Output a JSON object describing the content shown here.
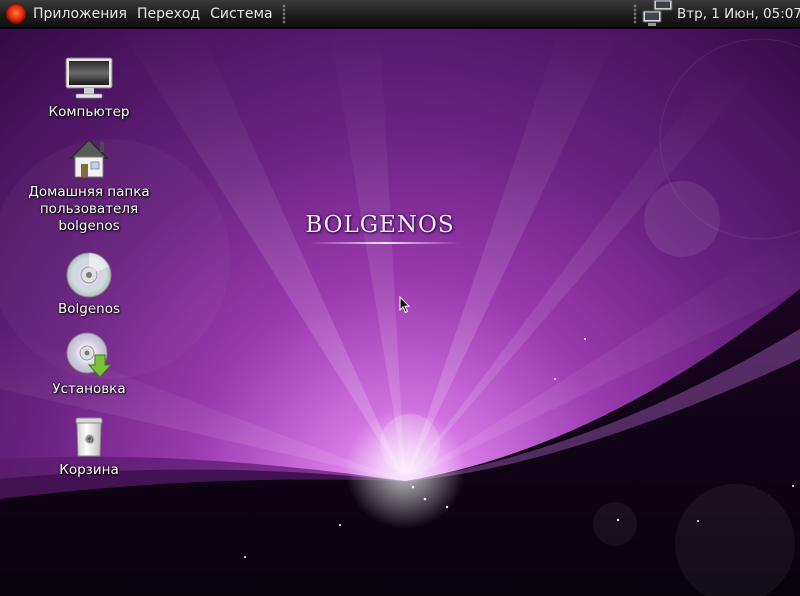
{
  "panel": {
    "menu": [
      "Приложения",
      "Переход",
      "Система"
    ],
    "clock": "Втр,  1 Июн, 05:07",
    "logo_icon": "distro-logo-icon",
    "network_icon": "network-icon"
  },
  "desktop": {
    "brand": "BOLGENOS",
    "icons": [
      {
        "label": "Компьютер",
        "icon": "computer-icon"
      },
      {
        "label_lines": [
          "Домашняя папка",
          "пользователя",
          "bolgenos"
        ],
        "icon": "home-folder-icon"
      },
      {
        "label": "Bolgenos",
        "icon": "cd-icon"
      },
      {
        "label": "Установка",
        "icon": "install-icon"
      },
      {
        "label": "Корзина",
        "icon": "trash-icon"
      }
    ]
  },
  "colors": {
    "wallpaper_dark": "#120418",
    "wallpaper_glow": "#e99cf2",
    "panel": "#1d1d1d"
  }
}
